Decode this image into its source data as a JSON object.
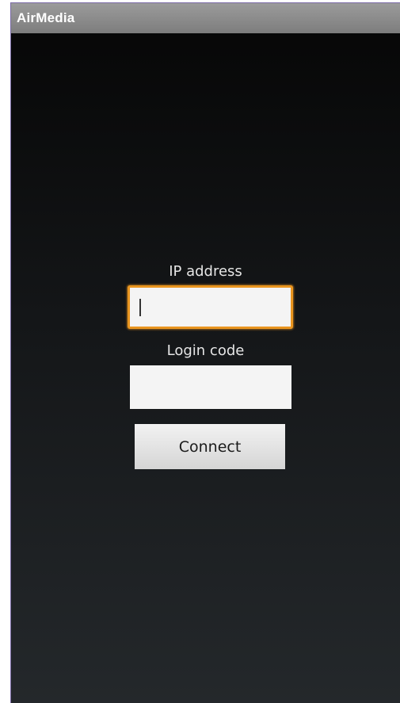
{
  "app": {
    "title": "AirMedia"
  },
  "form": {
    "ip_label": "IP address",
    "ip_value": "",
    "login_label": "Login code",
    "login_value": "",
    "connect_label": "Connect"
  },
  "colors": {
    "focus_border": "#e9951f",
    "titlebar": "#8c8c8c",
    "background_top": "#060606",
    "background_bottom": "#24282b"
  }
}
